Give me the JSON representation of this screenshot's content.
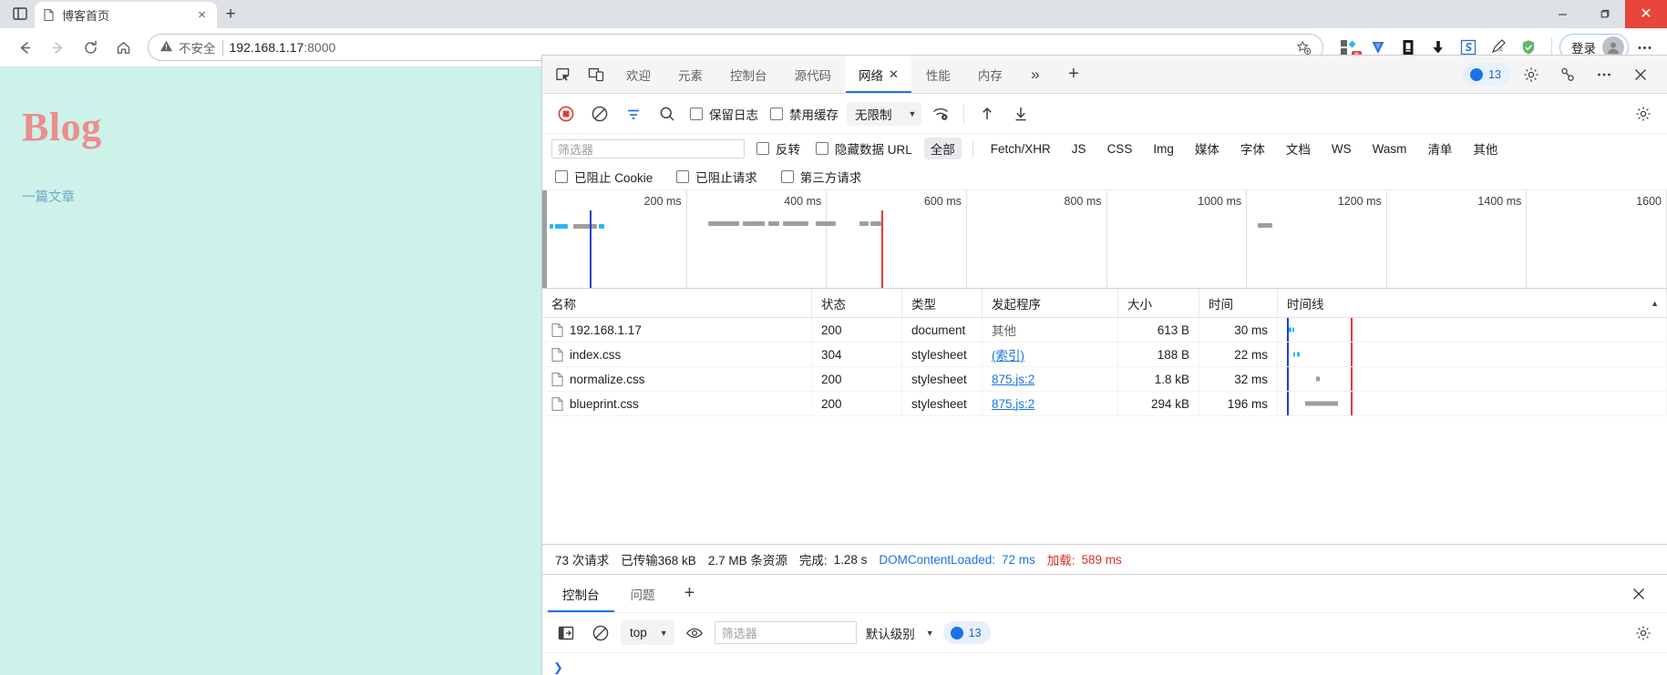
{
  "browser": {
    "tab": {
      "title": "博客首页",
      "close_label": "×",
      "favicon": "page-icon"
    },
    "new_tab_label": "+",
    "window_controls": {
      "minimize": "—",
      "maximize": "❐",
      "close": "✕"
    },
    "nav": {
      "back": "←",
      "forward": "→",
      "reload": "⟳",
      "home": "⌂"
    },
    "omnibox": {
      "security_label": "不安全",
      "security_icon": "warning-triangle-icon",
      "url_host": "192.168.1.17",
      "url_port": ":8000",
      "bookmark_icon": "star-plus-icon"
    },
    "extensions": [
      {
        "name": "extensions-puzzle-icon",
        "badge": "8"
      },
      {
        "name": "shield-v-icon",
        "badge": ""
      },
      {
        "name": "black-square-icon",
        "badge": ""
      },
      {
        "name": "download-arrow-icon",
        "badge": ""
      },
      {
        "name": "s-logo-icon",
        "badge": ""
      },
      {
        "name": "translate-pen-icon",
        "badge": ""
      },
      {
        "name": "green-shield-icon",
        "badge": ""
      }
    ],
    "profile": {
      "label": "登录",
      "avatar": "user-avatar-icon"
    },
    "more_menu": "⋮"
  },
  "page": {
    "heading": "Blog",
    "article_link": "一篇文章"
  },
  "devtools": {
    "left_icons": [
      "inspect-element-icon",
      "device-toolbar-icon"
    ],
    "tabs": [
      {
        "label": "欢迎",
        "active": false,
        "closable": false
      },
      {
        "label": "元素",
        "active": false,
        "closable": false
      },
      {
        "label": "控制台",
        "active": false,
        "closable": false
      },
      {
        "label": "源代码",
        "active": false,
        "closable": false
      },
      {
        "label": "网络",
        "active": true,
        "closable": true,
        "close_label": "✕"
      },
      {
        "label": "性能",
        "active": false,
        "closable": false
      },
      {
        "label": "内存",
        "active": false,
        "closable": false
      }
    ],
    "more_tabs_label": "»",
    "add_tab_label": "+",
    "issues_count": "13",
    "settings_icon": "gear-icon",
    "devices_icon": "devices-icon",
    "more_icon": "more-dots-icon",
    "close_icon": "close-icon",
    "network_toolbar": {
      "record_icon": "record-stop-icon",
      "clear_icon": "clear-circle-icon",
      "filter_icon": "filter-icon",
      "search_icon": "search-icon",
      "preserve_log_label": "保留日志",
      "disable_cache_label": "禁用缓存",
      "throttling_value": "无限制",
      "wifi_icon": "network-conditions-icon",
      "upload_icon": "import-har-icon",
      "download_icon": "export-har-icon",
      "panel_settings_icon": "gear-icon"
    },
    "filter_row": {
      "filter_placeholder": "筛选器",
      "invert_label": "反转",
      "hide_data_urls_label": "隐藏数据 URL",
      "types": [
        "全部",
        "Fetch/XHR",
        "JS",
        "CSS",
        "Img",
        "媒体",
        "字体",
        "文档",
        "WS",
        "Wasm",
        "清单",
        "其他"
      ],
      "active_type": "全部"
    },
    "blocked_row": {
      "blocked_cookies_label": "已阻止 Cookie",
      "blocked_requests_label": "已阻止请求",
      "third_party_label": "第三方请求"
    },
    "overview": {
      "ticks": [
        "200 ms",
        "400 ms",
        "600 ms",
        "800 ms",
        "1000 ms",
        "1200 ms",
        "1400 ms",
        "1600"
      ],
      "dom_marker_ms": 72,
      "load_marker_ms": 589
    },
    "table": {
      "columns": [
        "名称",
        "状态",
        "类型",
        "发起程序",
        "大小",
        "时间",
        "时间线"
      ],
      "sort_indicator": "▲",
      "rows": [
        {
          "name": "192.168.1.17",
          "status": "200",
          "type": "document",
          "initiator": "其他",
          "initiator_link": false,
          "size": "613 B",
          "time": "30 ms"
        },
        {
          "name": "index.css",
          "status": "304",
          "type": "stylesheet",
          "initiator": "(索引)",
          "initiator_link": true,
          "size": "188 B",
          "time": "22 ms"
        },
        {
          "name": "normalize.css",
          "status": "200",
          "type": "stylesheet",
          "initiator": "875.js:2",
          "initiator_link": true,
          "size": "1.8 kB",
          "time": "32 ms"
        },
        {
          "name": "blueprint.css",
          "status": "200",
          "type": "stylesheet",
          "initiator": "875.js:2",
          "initiator_link": true,
          "size": "294 kB",
          "time": "196 ms"
        }
      ]
    },
    "summary": {
      "requests": "73 次请求",
      "transferred": "已传输368 kB",
      "resources": "2.7 MB 条资源",
      "finish_label": "完成:",
      "finish_value": "1.28 s",
      "dom_label": "DOMContentLoaded:",
      "dom_value": "72 ms",
      "load_label": "加载:",
      "load_value": "589 ms"
    },
    "drawer": {
      "tabs": [
        {
          "label": "控制台",
          "active": true
        },
        {
          "label": "问题",
          "active": false
        }
      ],
      "add_label": "+",
      "close_icon": "close-icon",
      "console_toolbar": {
        "sidebar_icon": "console-sidebar-icon",
        "clear_icon": "clear-console-icon",
        "context_value": "top",
        "eye_icon": "live-expression-icon",
        "filter_placeholder": "筛选器",
        "level_value": "默认级别",
        "issues_count": "13",
        "settings_icon": "gear-icon"
      },
      "prompt": "❯"
    }
  },
  "colors": {
    "accent": "#1a73e8",
    "page_bg": "#ccf2ea",
    "heading": "#ec8d8d",
    "link": "#6ea8c4",
    "error": "#d93025",
    "load_marker": "#e53935",
    "dom_marker": "#1a3fd4"
  }
}
